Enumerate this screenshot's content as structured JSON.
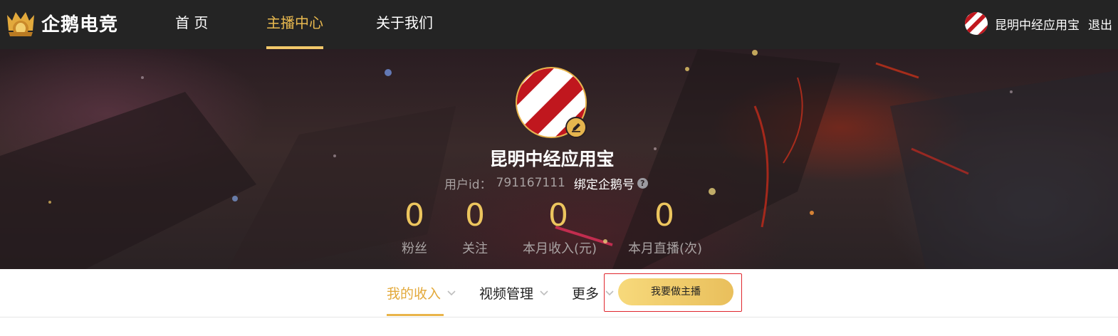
{
  "brand": {
    "logo_text": "企鹅电竞"
  },
  "nav": {
    "items": [
      {
        "label": "首 页"
      },
      {
        "label": "主播中心"
      },
      {
        "label": "关于我们"
      }
    ]
  },
  "user": {
    "name": "昆明中经应用宝",
    "logout_label": "退出"
  },
  "profile": {
    "name": "昆明中经应用宝",
    "id_label": "用户id：",
    "id_value": "791167111",
    "bind_label": "绑定企鹅号",
    "help_glyph": "?"
  },
  "stats": [
    {
      "value": "0",
      "label": "粉丝"
    },
    {
      "value": "0",
      "label": "关注"
    },
    {
      "value": "0",
      "label": "本月收入(元)"
    },
    {
      "value": "0",
      "label": "本月直播(次)"
    }
  ],
  "tabs": [
    {
      "label": "我的收入"
    },
    {
      "label": "视频管理"
    },
    {
      "label": "更多"
    }
  ],
  "cta": {
    "label": "我要做主播"
  },
  "colors": {
    "accent": "#e9b94f",
    "topbar": "#242424",
    "highlight": "#e0262d"
  }
}
